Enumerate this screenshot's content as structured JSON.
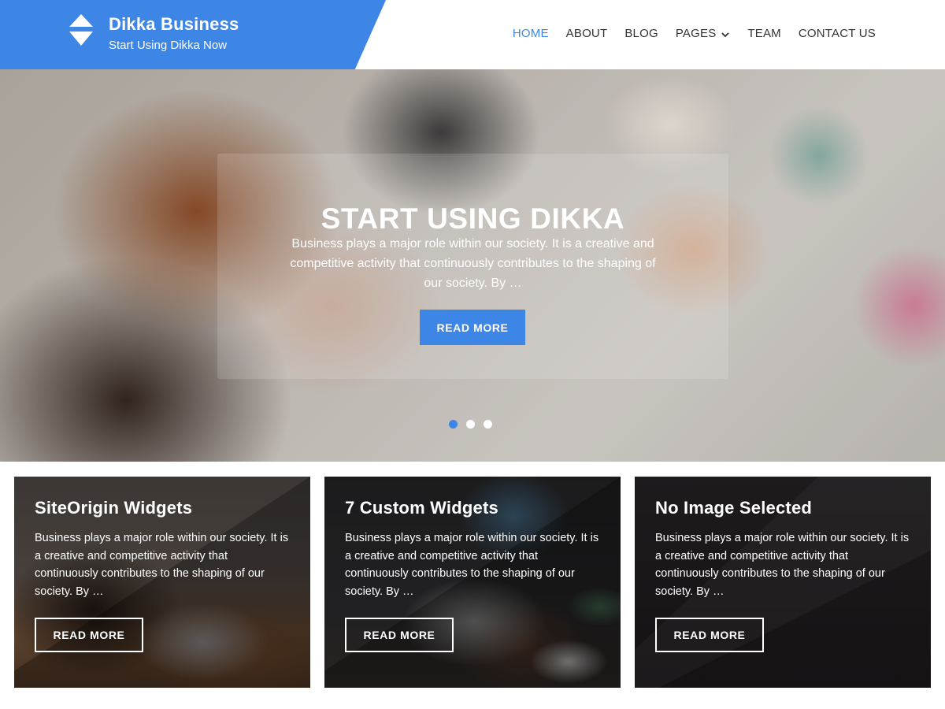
{
  "header": {
    "site_title": "Dikka Business",
    "tagline": "Start Using Dikka Now",
    "logo_icon": "diamond-logo-icon",
    "brand_color": "#3d86e6"
  },
  "nav": {
    "items": [
      {
        "label": "HOME",
        "active": true
      },
      {
        "label": "ABOUT",
        "active": false
      },
      {
        "label": "BLOG",
        "active": false
      },
      {
        "label": "PAGES",
        "active": false,
        "dropdown_icon": "chevron-down-icon"
      },
      {
        "label": "TEAM",
        "active": false
      },
      {
        "label": "CONTACT US",
        "active": false
      }
    ],
    "active_color": "#3d86e6",
    "text_color": "#333333"
  },
  "hero": {
    "title": "START USING DIKKA",
    "text": "Business plays a major role within our society. It is a creative and competitive activity that continuously contributes to the shaping of our society. By …",
    "button_label": "READ MORE",
    "slides": 3,
    "active_slide": 1
  },
  "cards": [
    {
      "title": "SiteOrigin Widgets",
      "text": "Business plays a major role within our society. It is a creative and competitive activity that continuously contributes to the shaping of our society. By …",
      "button_label": "READ MORE"
    },
    {
      "title": "7 Custom Widgets",
      "text": "Business plays a major role within our society. It is a creative and competitive activity that continuously contributes to the shaping of our society. By …",
      "button_label": "READ MORE"
    },
    {
      "title": "No Image Selected",
      "text": "Business plays a major role within our society. It is a creative and competitive activity that continuously contributes to the shaping of our society. By …",
      "button_label": "READ MORE"
    }
  ]
}
